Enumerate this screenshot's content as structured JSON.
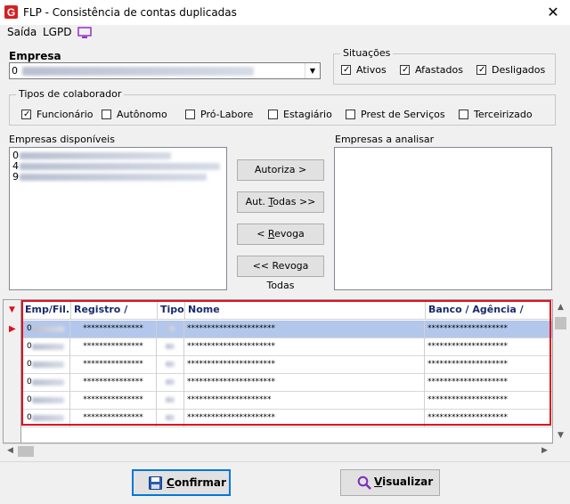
{
  "window": {
    "title": "FLP - Consistência de contas duplicadas",
    "close_glyph": "✕"
  },
  "menu": {
    "items": [
      "Saída",
      "LGPD"
    ]
  },
  "empresa": {
    "label": "Empresa",
    "selected_prefix": "0"
  },
  "situacoes": {
    "legend": "Situações",
    "options": [
      {
        "label": "Ativos",
        "checked": true
      },
      {
        "label": "Afastados",
        "checked": true
      },
      {
        "label": "Desligados",
        "checked": true
      }
    ]
  },
  "tipos": {
    "legend": "Tipos de colaborador",
    "options": [
      {
        "label": "Funcionário",
        "checked": true
      },
      {
        "label": "Autônomo",
        "checked": false
      },
      {
        "label": "Pró-Labore",
        "checked": false
      },
      {
        "label": "Estagiário",
        "checked": false
      },
      {
        "label": "Prest de Serviços",
        "checked": false
      },
      {
        "label": "Terceirizado",
        "checked": false
      }
    ]
  },
  "disponiveis": {
    "label": "Empresas disponíveis",
    "items": [
      "0",
      "4",
      "9"
    ]
  },
  "analisar": {
    "label": "Empresas a analisar"
  },
  "actions": {
    "autoriza": "Autoriza >",
    "aut_todas_pre": "Aut. ",
    "aut_todas_u": "T",
    "aut_todas_post": "odas >>",
    "revoga_pre": "< ",
    "revoga_u": "R",
    "revoga_post": "evoga",
    "revoga_todas": "<< Revoga Todas"
  },
  "grid": {
    "columns": [
      "Emp/Fil.",
      "Registro / Chapa",
      "Tipo",
      "Nome",
      "Banco / Agência / Conta"
    ],
    "rows": [
      {
        "emp": "0",
        "registro": "***************",
        "nome": "**********************",
        "banco": "********************"
      },
      {
        "emp": "0",
        "registro": "***************",
        "nome": "**********************",
        "banco": "********************"
      },
      {
        "emp": "0",
        "registro": "***************",
        "nome": "**********************",
        "banco": "********************"
      },
      {
        "emp": "0",
        "registro": "***************",
        "nome": "**********************",
        "banco": "********************"
      },
      {
        "emp": "0",
        "registro": "***************",
        "nome": "*********************",
        "banco": "********************"
      },
      {
        "emp": "0",
        "registro": "***************",
        "nome": "**********************",
        "banco": "********************"
      }
    ]
  },
  "footer": {
    "confirmar_u": "C",
    "confirmar_rest": "onfirmar",
    "visualizar_u": "V",
    "visualizar_rest": "isualizar"
  },
  "colors": {
    "highlight": "#e01020",
    "selected_row": "#b3c7ec",
    "accent": "#1a2a6c"
  }
}
